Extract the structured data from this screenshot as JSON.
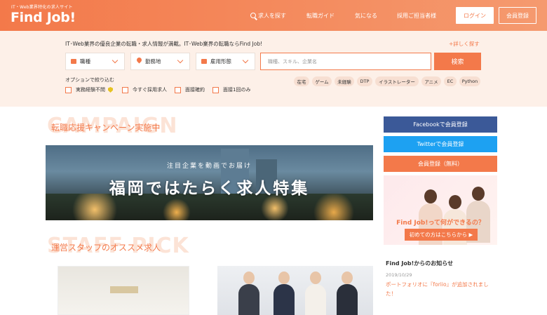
{
  "header": {
    "logo_sub": "IT・Web業界特化の求人サイト",
    "logo": "Find Job!",
    "nav": {
      "search": "求人を探す",
      "guide": "転職ガイド",
      "favorites": "気になる",
      "recruiter": "採用ご担当者様"
    },
    "login": "ログイン",
    "register": "会員登録"
  },
  "search": {
    "tagline": "IT･Web業界の優良企業の転職・求人情報が満載。IT･Web業界の転職ならFind Job!",
    "detail_link": "+詳しく探す",
    "selects": {
      "job_type": "職種",
      "location": "勤務地",
      "employment": "雇用形態"
    },
    "keyword_placeholder": "職種、スキル、企業名",
    "button": "検索",
    "options_label": "オプションで絞り込む",
    "options": [
      "実務経験不問",
      "今すぐ採用求人",
      "面接確約",
      "面接1回のみ"
    ],
    "tags": [
      "在宅",
      "ゲーム",
      "未経験",
      "DTP",
      "イラストレーター",
      "アニメ",
      "EC",
      "Python"
    ]
  },
  "campaign": {
    "title": "転職応援キャンペーン実施中",
    "bg_text": "CAMPAIGN",
    "banner_sub": "注目企業を動画でお届け",
    "banner_title": "福岡ではたらく求人特集"
  },
  "staff_pick": {
    "title": "運営スタッフのオススメ求人",
    "bg_text": "STAFF PICK"
  },
  "sidebar": {
    "facebook": "Facebookで会員登録",
    "twitter": "Twitterで会員登録",
    "free_register": "会員登録（無料）",
    "banner_question": "Find Job!って何ができるの？",
    "banner_button": "初めての方はこちらから ▶",
    "news_title": "Find Job!からのお知らせ",
    "news_date": "2019/10/29",
    "news_text": "ポートフォリオに『foriio』が追加されました！"
  },
  "colors": {
    "accent": "#f3794a",
    "facebook": "#3b5998",
    "twitter": "#1da1f2"
  }
}
